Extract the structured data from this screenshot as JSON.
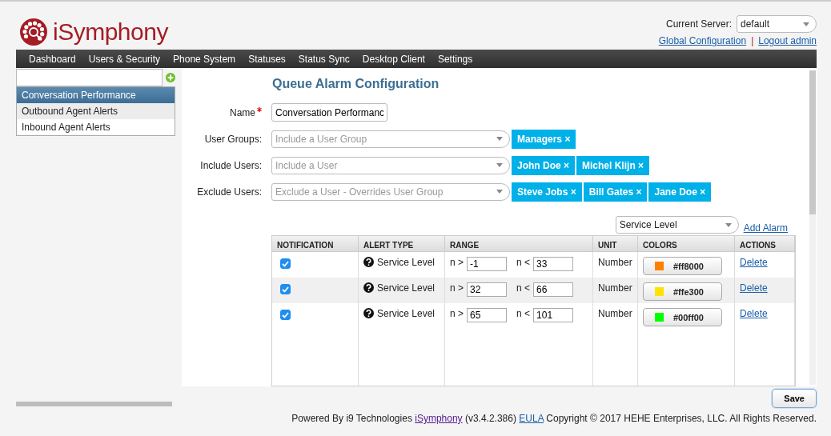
{
  "header": {
    "logo_text": "iSymphony",
    "server_label": "Current Server:",
    "server_value": "default",
    "links": [
      "Global Configuration",
      "Logout admin"
    ],
    "separator": "|"
  },
  "nav": [
    "Dashboard",
    "Users & Security",
    "Phone System",
    "Statuses",
    "Status Sync",
    "Desktop Client",
    "Settings"
  ],
  "sidebar": {
    "items": [
      {
        "label": "Conversation Performance",
        "selected": true,
        "hovered": false
      },
      {
        "label": "Outbound Agent Alerts",
        "selected": false,
        "hovered": true
      },
      {
        "label": "Inbound Agent Alerts",
        "selected": false,
        "hovered": false
      }
    ]
  },
  "form": {
    "title": "Queue Alarm Configuration",
    "fields": [
      {
        "kind": "text",
        "label": "Name",
        "required": true,
        "value": "Conversation Performanc"
      },
      {
        "kind": "select",
        "label": "User Groups:",
        "required": false,
        "placeholder": "Include a User Group",
        "chips": [
          "Managers"
        ]
      },
      {
        "kind": "select",
        "label": "Include Users:",
        "required": false,
        "placeholder": "Include a User",
        "chips": [
          "John Doe",
          "Michel Klijn"
        ]
      },
      {
        "kind": "select",
        "label": "Exclude Users:",
        "required": false,
        "placeholder": "Exclude a User - Overrides User Group",
        "chips": [
          "Steve Jobs",
          "Bill Gates",
          "Jane Doe"
        ]
      }
    ],
    "chip_close": "×"
  },
  "alarm_picker": {
    "value": "Service Level",
    "add_link": "Add Alarm"
  },
  "table": {
    "columns": [
      "NOTIFICATION",
      "ALERT TYPE",
      "RANGE",
      "UNIT",
      "COLORS",
      "ACTIONS"
    ],
    "rows": [
      {
        "checked": true,
        "alert_type": "Service Level",
        "min_prefix": "n >",
        "min": "-1",
        "max_prefix": "n <",
        "max": "33",
        "unit": "Number",
        "color": "#ff8000",
        "color_label": "#ff8000",
        "action": "Delete"
      },
      {
        "checked": true,
        "alert_type": "Service Level",
        "min_prefix": "n >",
        "min": "32",
        "max_prefix": "n <",
        "max": "66",
        "unit": "Number",
        "color": "#ffe300",
        "color_label": "#ffe300",
        "action": "Delete"
      },
      {
        "checked": true,
        "alert_type": "Service Level",
        "min_prefix": "n >",
        "min": "65",
        "max_prefix": "n <",
        "max": "101",
        "unit": "Number",
        "color": "#00ff00",
        "color_label": "#00ff00",
        "action": "Delete"
      }
    ]
  },
  "save": "Save",
  "footer": [
    {
      "kind": "text",
      "text": "Powered By i9 Technologies "
    },
    {
      "kind": "link",
      "text": "iSymphony",
      "visited": true
    },
    {
      "kind": "text",
      "text": " (v3.4.2.386) "
    },
    {
      "kind": "link",
      "text": "EULA",
      "visited": false
    },
    {
      "kind": "text",
      "text": " Copyright © 2017 HEHE Enterprises, LLC. All Rights Reserved."
    }
  ]
}
